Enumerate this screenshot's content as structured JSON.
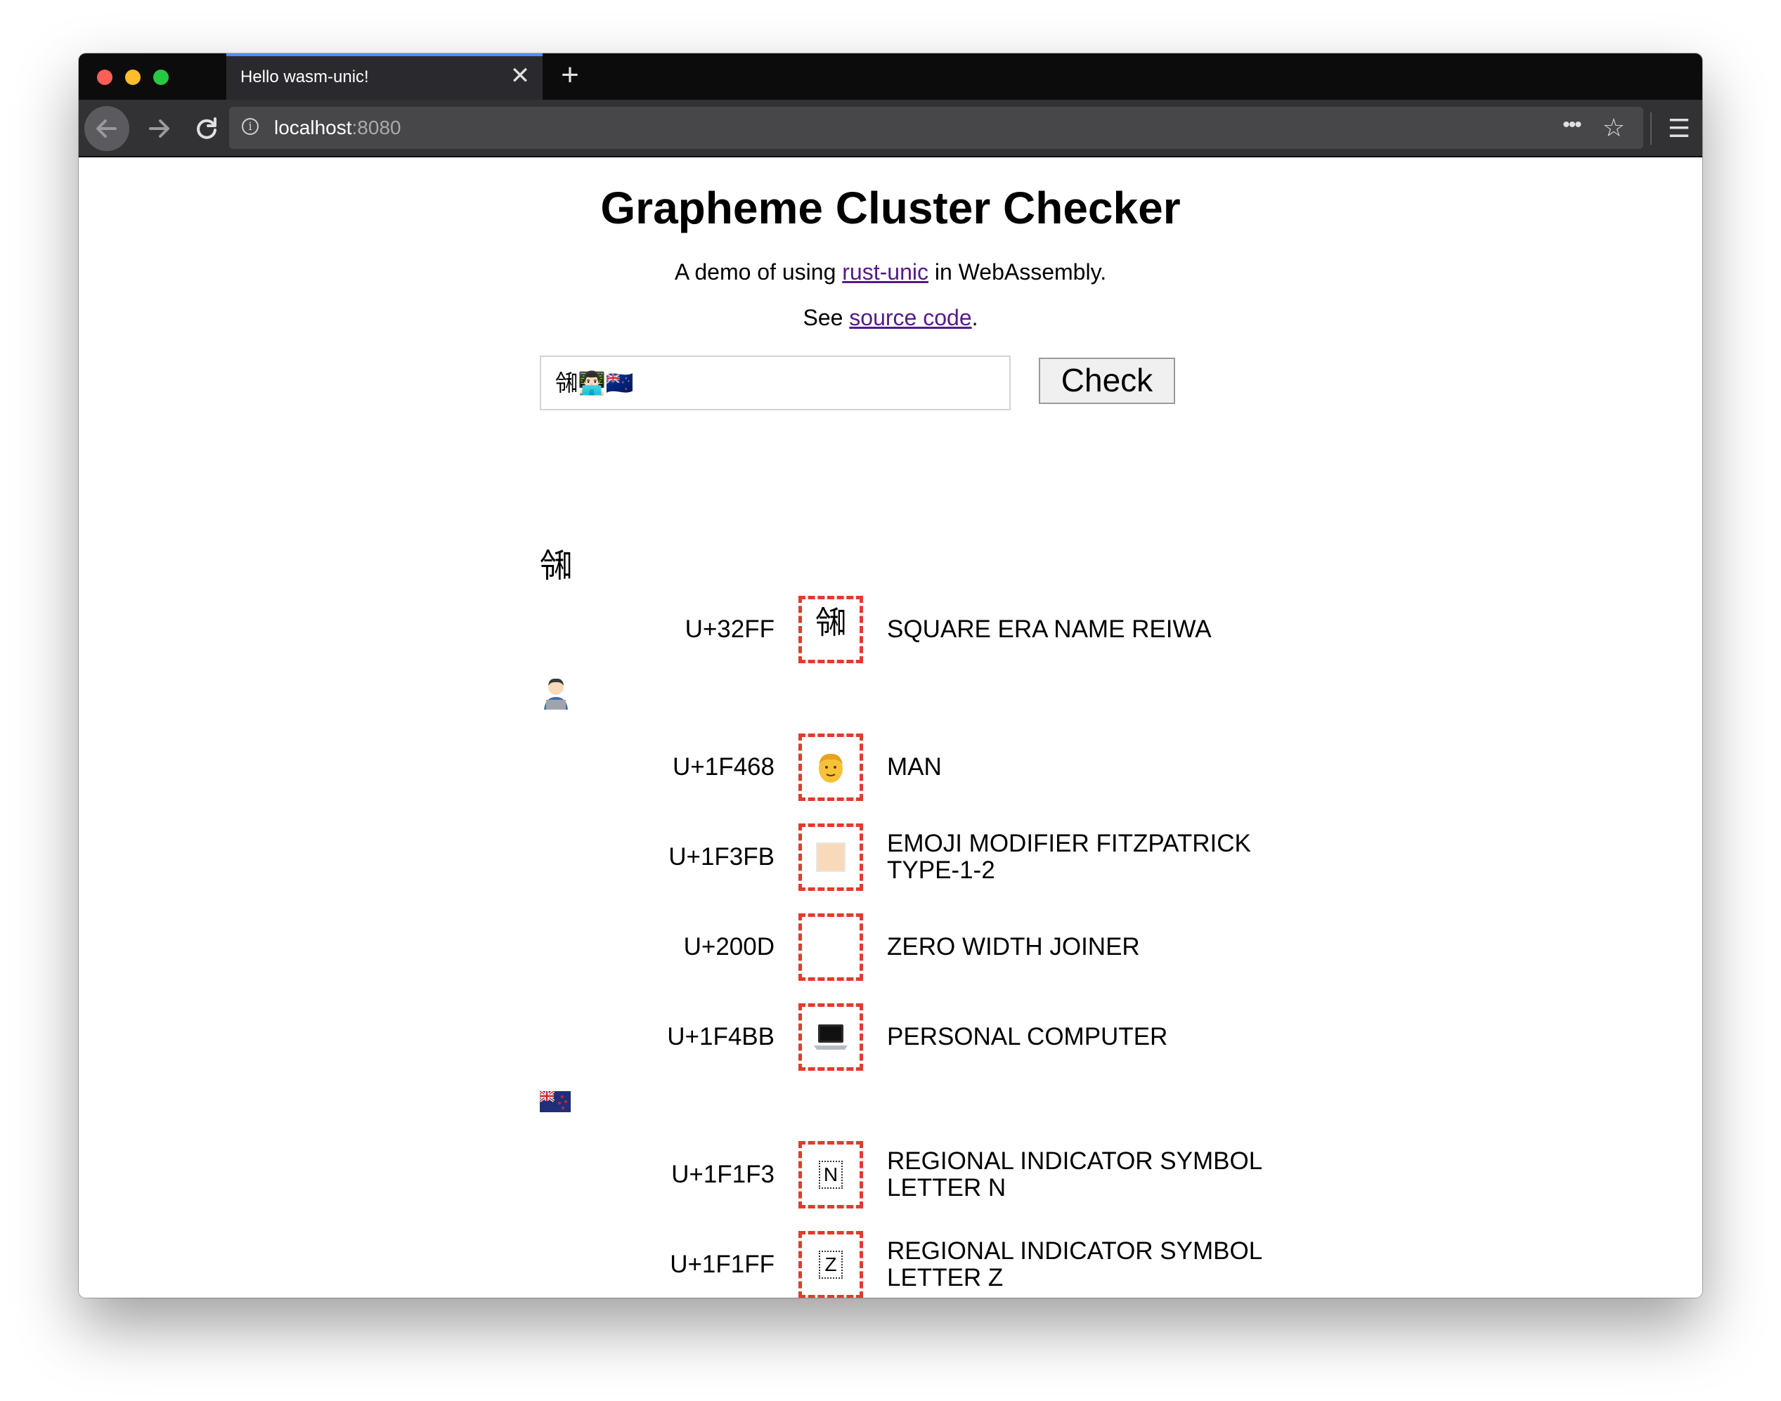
{
  "browser": {
    "tab_title": "Hello wasm-unic!",
    "tab_close": "✕",
    "new_tab": "+",
    "url_host": "localhost",
    "url_port": ":8080",
    "more": "•••",
    "star": "☆",
    "menu": "☰",
    "info": "i"
  },
  "page": {
    "title": "Grapheme Cluster Checker",
    "subtitle_prefix": "A demo of using ",
    "subtitle_link": "rust-unic",
    "subtitle_suffix": " in WebAssembly.",
    "source_prefix": "See ",
    "source_link": "source code",
    "source_suffix": "."
  },
  "form": {
    "input_value": "㋿👨🏻‍💻🇳🇿",
    "button_label": "Check"
  },
  "clusters": [
    {
      "heading": "㋿",
      "code_points": [
        {
          "code": "U+32FF",
          "glyph": "㋿",
          "glyph_icon": "reiwa-glyph",
          "name": "SQUARE ERA NAME REIWA"
        }
      ]
    },
    {
      "heading": "👨🏻‍💻",
      "code_points": [
        {
          "code": "U+1F468",
          "glyph_icon": "man-emoji",
          "name": "MAN"
        },
        {
          "code": "U+1F3FB",
          "glyph_icon": "skin-tone-swatch",
          "name": "EMOJI MODIFIER FITZPATRICK TYPE-1-2"
        },
        {
          "code": "U+200D",
          "glyph_icon": "empty",
          "name": "ZERO WIDTH JOINER"
        },
        {
          "code": "U+1F4BB",
          "glyph_icon": "laptop-emoji",
          "name": "PERSONAL COMPUTER"
        }
      ]
    },
    {
      "heading": "🇳🇿",
      "code_points": [
        {
          "code": "U+1F1F3",
          "glyph": "N",
          "glyph_icon": "regional-indicator-n",
          "name": "REGIONAL INDICATOR SYMBOL LETTER N"
        },
        {
          "code": "U+1F1FF",
          "glyph": "Z",
          "glyph_icon": "regional-indicator-z",
          "name": "REGIONAL INDICATOR SYMBOL LETTER Z"
        }
      ]
    }
  ],
  "colors": {
    "dashed_border": "#e23b2c",
    "link": "#551a8b",
    "tab_accent": "#4f8ef7"
  }
}
